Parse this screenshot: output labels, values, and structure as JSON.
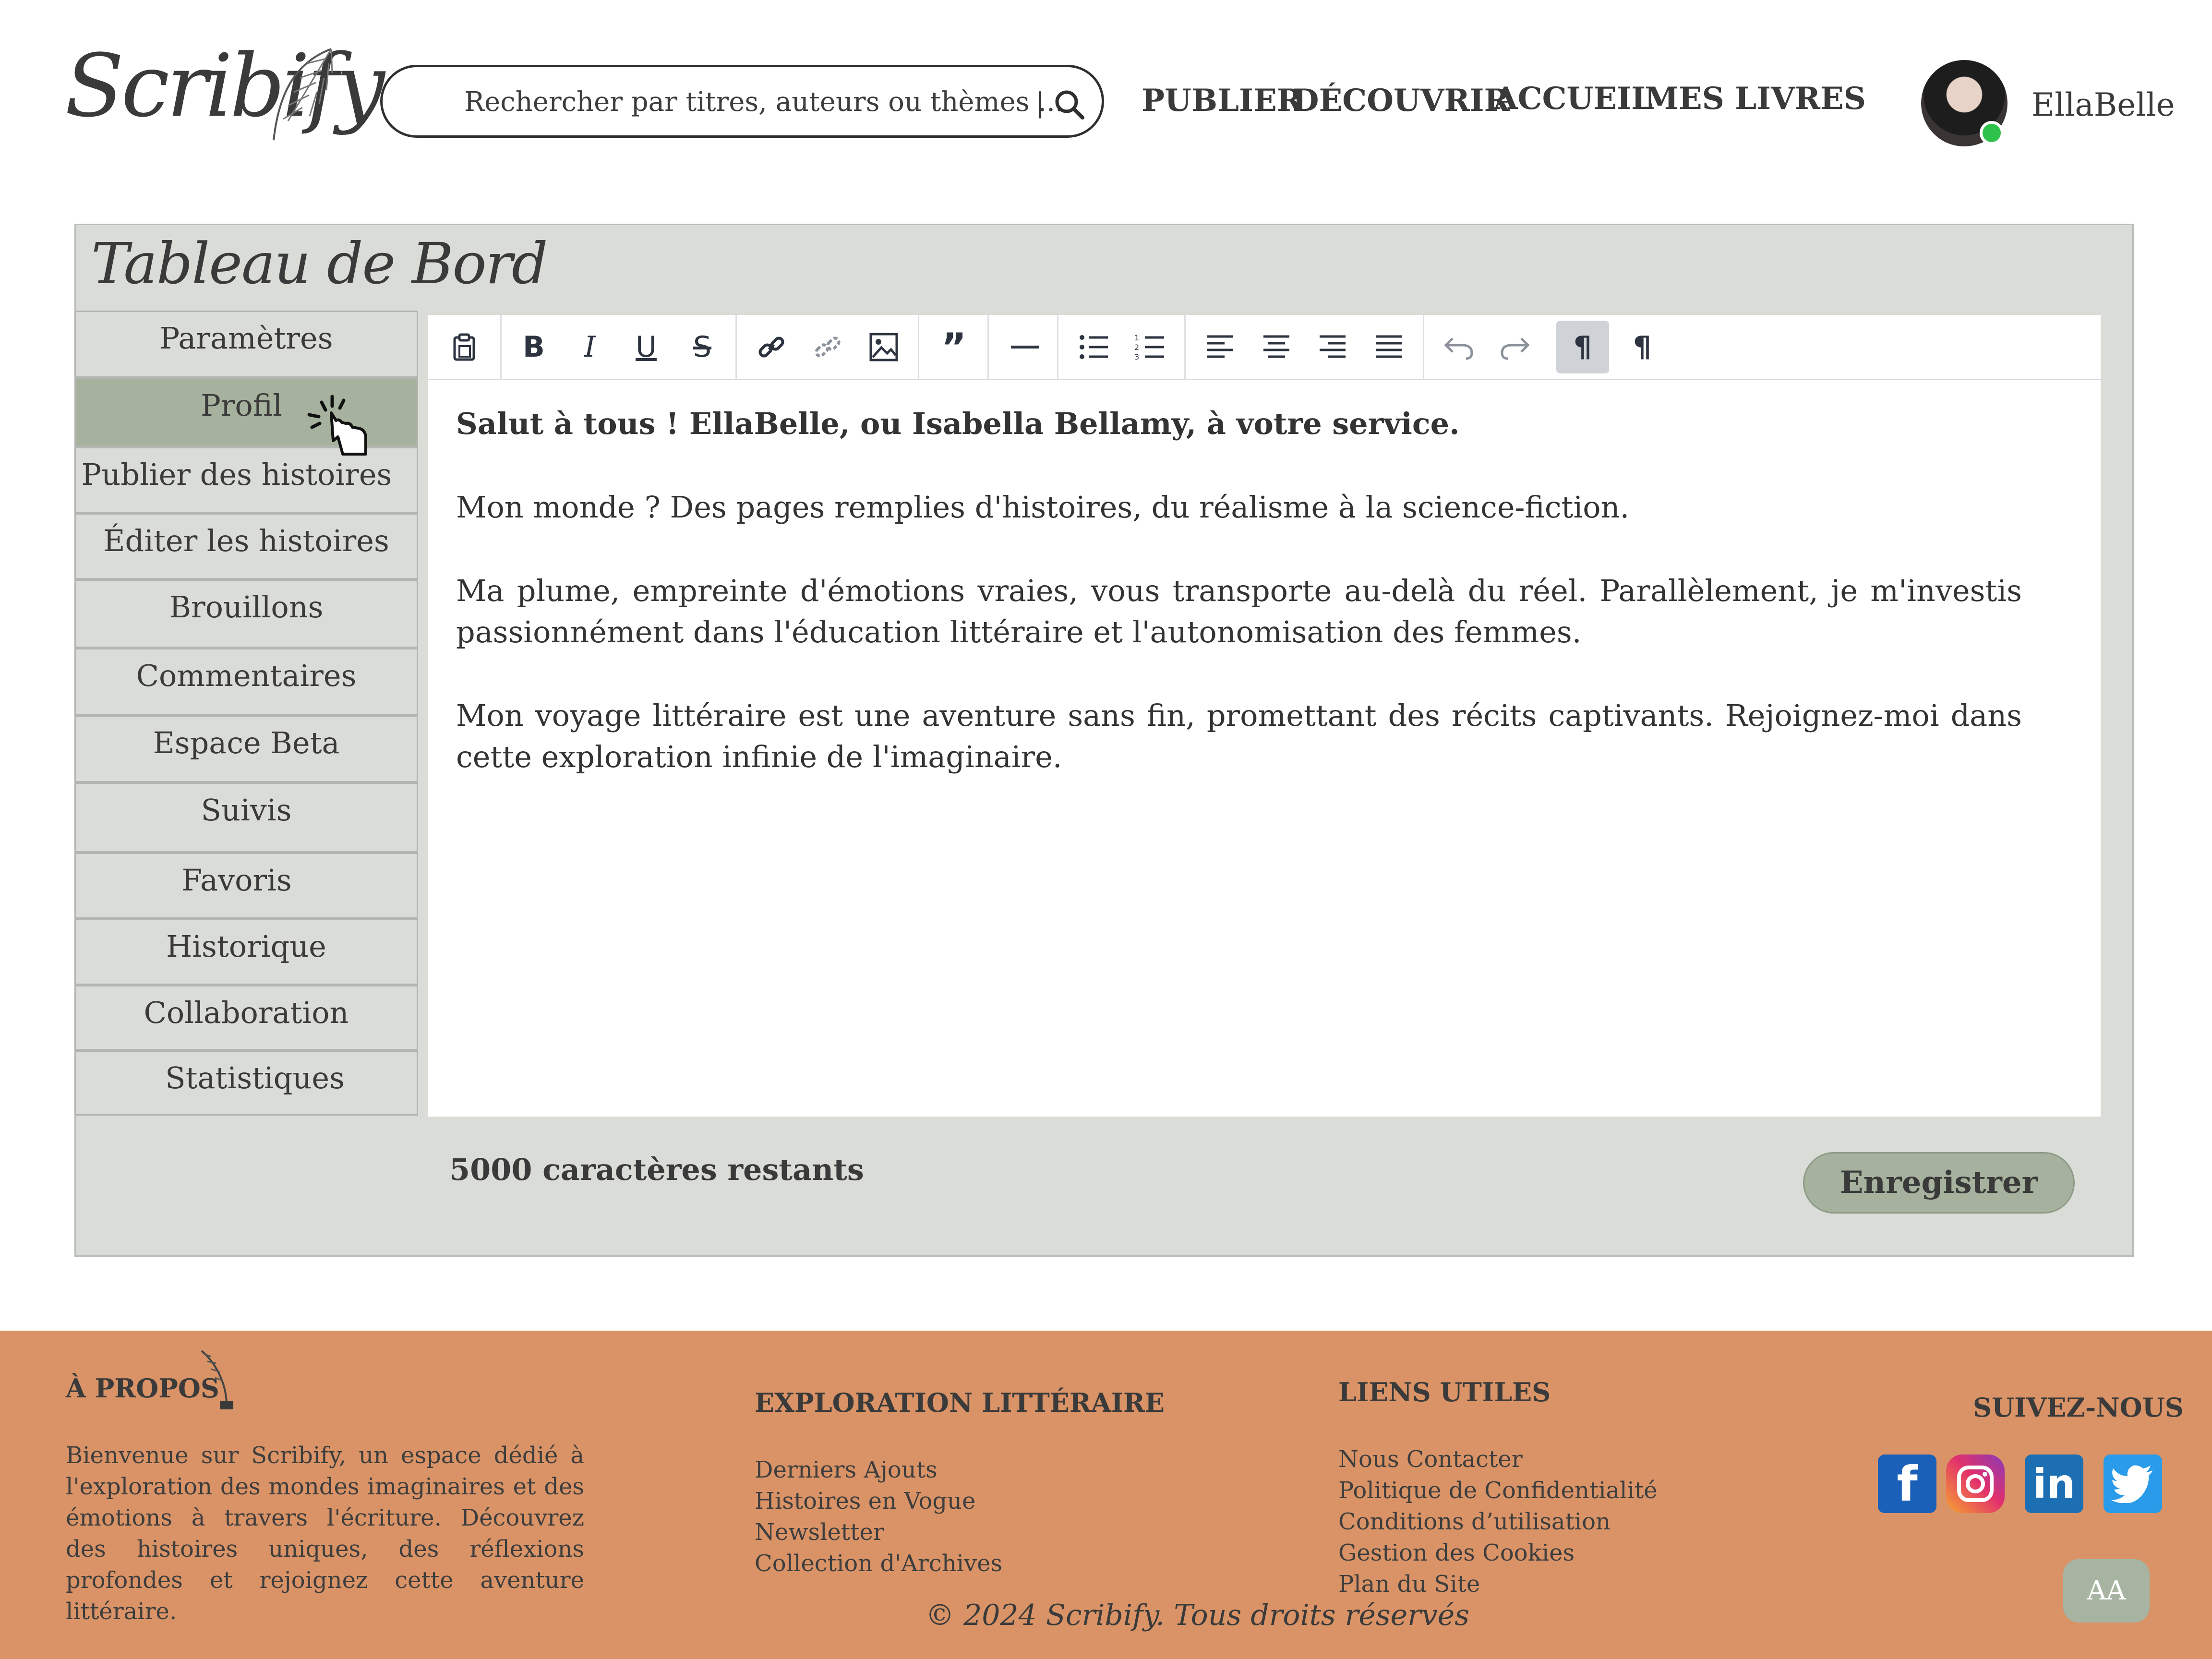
{
  "header": {
    "logo": "Scribify",
    "search_placeholder": "Rechercher par titres, auteurs ou thèmes ...",
    "search_separator": "|",
    "nav": [
      "PUBLIER",
      "DÉCOUVRIR",
      "ACCUEIL",
      "MES LIVRES"
    ],
    "username": "EllaBelle"
  },
  "dashboard": {
    "title": "Tableau de Bord",
    "sidebar": [
      {
        "label": "Paramètres"
      },
      {
        "label": "Profil"
      },
      {
        "label": "Publier des histoires"
      },
      {
        "label": "Éditer les histoires"
      },
      {
        "label": "Brouillons"
      },
      {
        "label": "Commentaires"
      },
      {
        "label": "Espace Beta"
      },
      {
        "label": "Suivis"
      },
      {
        "label": "Favoris"
      },
      {
        "label": "Historique"
      },
      {
        "label": "Collaboration"
      },
      {
        "label": "Statistiques"
      }
    ],
    "active_item": "Profil",
    "toolbar": [
      "paste-icon",
      "bold-icon",
      "italic-icon",
      "underline-icon",
      "strikethrough-icon",
      "link-icon",
      "unlink-icon",
      "image-icon",
      "quote-icon",
      "horizontal-rule-icon",
      "bullet-list-icon",
      "numbered-list-icon",
      "align-left-icon",
      "align-center-icon",
      "align-right-icon",
      "align-justify-icon",
      "undo-icon",
      "redo-icon",
      "ltr-icon",
      "rtl-icon"
    ],
    "editor": {
      "p1": "Salut à tous ! EllaBelle, ou Isabella Bellamy, à votre service.",
      "p2": "Mon monde ? Des pages remplies d'histoires, du réalisme à la science-fiction.",
      "p3": "Ma plume, empreinte d'émotions vraies, vous transporte au-delà du réel. Parallèlement, je m'investis passionnément dans l'éducation littéraire et l'autonomisation des femmes.",
      "p4": "Mon voyage littéraire est une aventure sans fin, promettant des récits captivants. Rejoignez-moi dans cette exploration infinie de l'imaginaire."
    },
    "chars_remaining": "5000 caractères restants",
    "save_label": "Enregistrer"
  },
  "footer": {
    "about_title": "À PROPOS",
    "about_text": "Bienvenue sur Scribify, un espace dédié à l'exploration des mondes imaginaires et des émotions à travers l'écriture. Découvrez des histoires uniques, des réflexions profondes et rejoignez cette aventure littéraire.",
    "exploration_title": "EXPLORATION LITTÉRAIRE",
    "exploration_links": [
      "Derniers Ajouts",
      "Histoires en Vogue",
      "Newsletter",
      "Collection d'Archives"
    ],
    "useful_title": "LIENS UTILES",
    "useful_links": [
      "Nous Contacter",
      "Politique de Confidentialité",
      "Conditions d’utilisation",
      "Gestion des Cookies",
      "Plan du Site"
    ],
    "follow_title": "SUIVEZ-NOUS",
    "social": [
      "facebook-icon",
      "instagram-icon",
      "linkedin-icon",
      "twitter-icon"
    ],
    "aa_label": "AA",
    "copyright": "© 2024 Scribify. Tous droits réservés"
  },
  "colors": {
    "accent_green": "#a6b29e",
    "panel_bg": "#dadcd7",
    "footer_bg": "#d99366",
    "online_dot": "#2fc24a"
  }
}
